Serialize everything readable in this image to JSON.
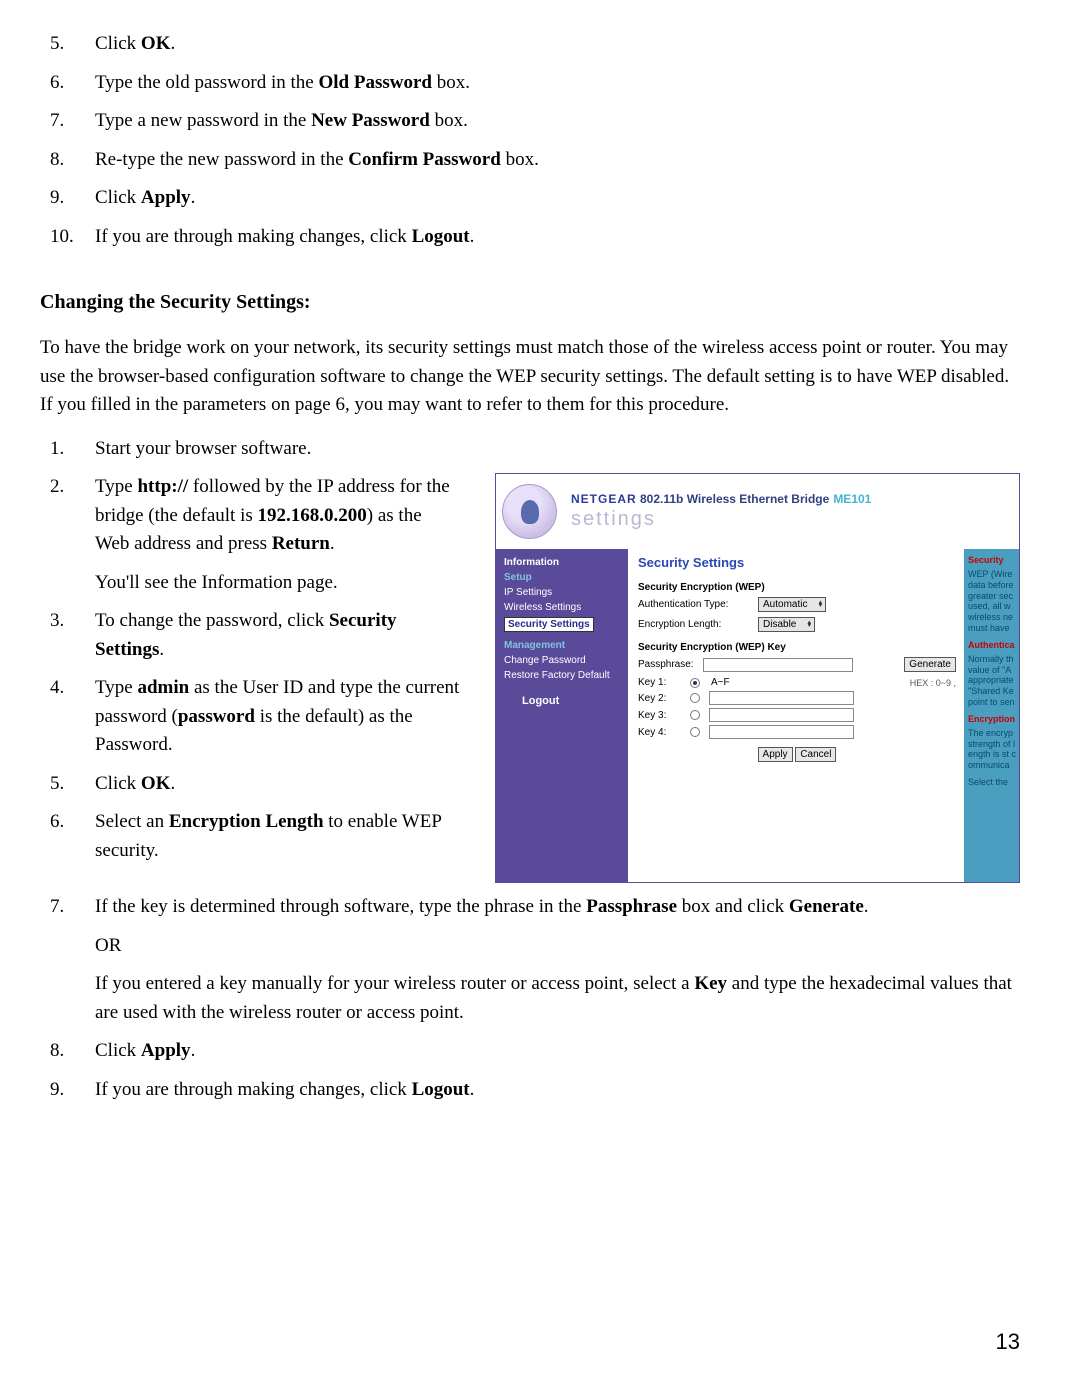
{
  "steps_top": [
    {
      "num": "5.",
      "prefix": "Click ",
      "bold": "OK",
      "suffix": "."
    },
    {
      "num": "6.",
      "prefix": "Type the old password in the ",
      "bold": "Old Password",
      "suffix": " box."
    },
    {
      "num": "7.",
      "prefix": "Type a new password in the ",
      "bold": "New Password",
      "suffix": " box."
    },
    {
      "num": "8.",
      "prefix": "Re-type the new password in the ",
      "bold": "Confirm Password",
      "suffix": " box."
    },
    {
      "num": "9.",
      "prefix": "Click ",
      "bold": "Apply",
      "suffix": "."
    },
    {
      "num": "10.",
      "prefix": "If you are through making changes, click ",
      "bold": "Logout",
      "suffix": "."
    }
  ],
  "section_heading": "Changing the Security Settings:",
  "intro_para": "To have the bridge work on your network, its security settings must match those of the wireless access point or router. You may use the browser-based configuration software to change the WEP security settings. The default setting is to have WEP disabled. If you filled in the parameters on page 6, you may want to refer to them for this procedure.",
  "step1_num": "1.",
  "step1_text": "Start your browser software.",
  "step2_num": "2.",
  "step2_a": "Type ",
  "step2_b": "http://",
  "step2_c": " followed by the IP address for the bridge (the default is ",
  "step2_d": "192.168.0.200",
  "step2_e": ") as the Web address and press ",
  "step2_f": "Return",
  "step2_g": ".",
  "step2_sub": "You'll see the Information page.",
  "step3_num": "3.",
  "step3_a": "To change the password, click ",
  "step3_b": "Security Settings",
  "step3_c": ".",
  "step4_num": "4.",
  "step4_a": "Type ",
  "step4_b": "admin",
  "step4_c": " as the User ID and type the current password (",
  "step4_d": "password",
  "step4_e": " is the default) as the Password.",
  "step5_num": "5.",
  "step5_a": "Click ",
  "step5_b": "OK",
  "step5_c": ".",
  "step6_num": "6.",
  "step6_a": "Select an ",
  "step6_b": "Encryption Length",
  "step6_c": " to enable WEP security.",
  "step7_num": "7.",
  "step7_a": "If the key is determined through software, type the phrase in the ",
  "step7_b": "Passphrase",
  "step7_c": " box and click ",
  "step7_d": "Generate",
  "step7_e": ".",
  "step7_or": "OR",
  "step7_sub_a": "If you entered a key manually for your wireless router or access point, select a ",
  "step7_sub_b": "Key",
  "step7_sub_c": " and type the hexadecimal values that are used with the wireless router or access point.",
  "step8_num": "8.",
  "step8_a": "Click ",
  "step8_b": "Apply",
  "step8_c": ".",
  "step9_num": "9.",
  "step9_a": "If you are through making changes, click ",
  "step9_b": "Logout",
  "step9_c": ".",
  "page_number": "13",
  "shot": {
    "brand_ng": "NETGEAR",
    "brand_rest": "  802.11b Wireless Ethernet Bridge",
    "model": "ME101",
    "settings_img": "settings",
    "sidebar": {
      "info": "Information",
      "setup": "Setup",
      "ip": "IP Settings",
      "ws": "Wireless Settings",
      "ss": "Security Settings",
      "mgmt": "Management",
      "cp": "Change Password",
      "rf": "Restore Factory Default",
      "logout": "Logout"
    },
    "main": {
      "title": "Security Settings",
      "encwep": "Security Encryption (WEP)",
      "authlabel": "Authentication Type:",
      "authval": "Automatic",
      "enclabel": "Encryption Length:",
      "encval": "Disable",
      "keyhdr": "Security Encryption (WEP) Key",
      "passlabel": "Passphrase:",
      "genbtn": "Generate",
      "key1": "Key 1:",
      "key2": "Key 2:",
      "key3": "Key 3:",
      "key4": "Key 4:",
      "hex": "HEX : 0~9 ,",
      "af": "A~F",
      "apply": "Apply",
      "cancel": "Cancel"
    },
    "right": {
      "h1": "Security",
      "t1": "WEP (Wire data before greater sec used, all w wireless ne must have",
      "h2": "Authentica",
      "t2": "Normally th value of \"A appropriate \"Shared Ke point to sen",
      "h3": "Encryption",
      "t3": "The encryp strength of length is st communica",
      "t4": "Select the"
    }
  }
}
